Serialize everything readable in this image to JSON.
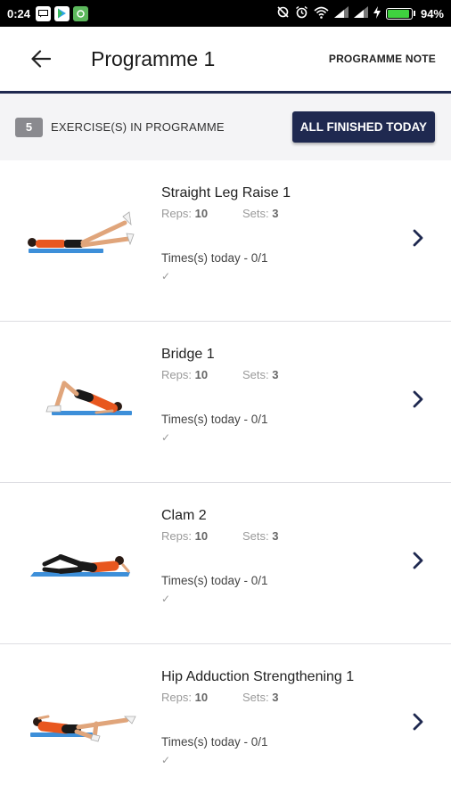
{
  "status_bar": {
    "time": "0:24",
    "battery": "94%",
    "battery_level": 0.94,
    "icons": [
      "message-icon",
      "play-store-icon",
      "app-icon",
      "sync-icon",
      "alarm-icon",
      "wifi-icon",
      "signal-icon",
      "signal-icon",
      "charging-icon",
      "battery-icon"
    ]
  },
  "app_bar": {
    "title": "Programme 1",
    "programme_note": "PROGRAMME NOTE",
    "back_icon": "arrow-left-icon"
  },
  "summary": {
    "count": "5",
    "label": "EXERCISE(S) IN PROGRAMME",
    "finish_button": "ALL FINISHED TODAY"
  },
  "colors": {
    "primary": "#1f2950",
    "badge": "#8a8a8f",
    "mat": "#3d8fd9",
    "shirt": "#e8571f",
    "shorts": "#1a1a1a"
  },
  "exercises": [
    {
      "name": "Straight Leg Raise 1",
      "reps_label": "Reps:",
      "reps": "10",
      "sets_label": "Sets:",
      "sets": "3",
      "times": "Times(s) today - 0/1",
      "check": "✓"
    },
    {
      "name": "Bridge 1",
      "reps_label": "Reps:",
      "reps": "10",
      "sets_label": "Sets:",
      "sets": "3",
      "times": "Times(s) today - 0/1",
      "check": "✓"
    },
    {
      "name": "Clam 2",
      "reps_label": "Reps:",
      "reps": "10",
      "sets_label": "Sets:",
      "sets": "3",
      "times": "Times(s) today - 0/1",
      "check": "✓"
    },
    {
      "name": "Hip Adduction Strengthening 1",
      "reps_label": "Reps:",
      "reps": "10",
      "sets_label": "Sets:",
      "sets": "3",
      "times": "Times(s) today - 0/1",
      "check": "✓"
    }
  ]
}
